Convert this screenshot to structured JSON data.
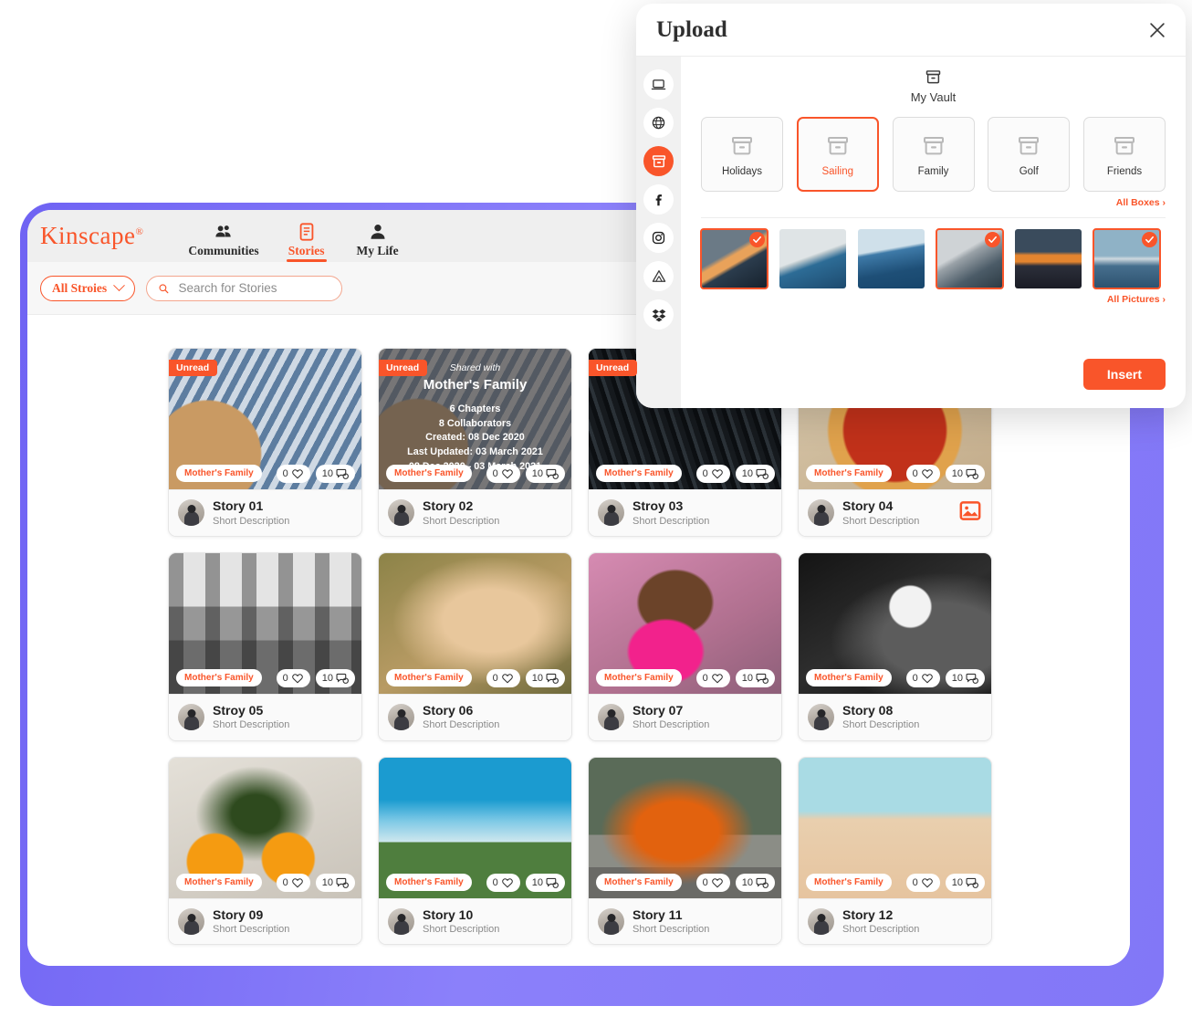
{
  "app": {
    "logo": "Kinscape",
    "logo_reg": "®",
    "nav": [
      {
        "label": "Communities",
        "icon": "people-icon",
        "active": false
      },
      {
        "label": "Stories",
        "icon": "document-icon",
        "active": true
      },
      {
        "label": "My Life",
        "icon": "person-icon",
        "active": false
      }
    ],
    "filter": {
      "label": "All Stroies",
      "icon": "chevron-down-icon"
    },
    "search": {
      "placeholder": "Search for Stories",
      "value": "",
      "icon": "search-icon"
    },
    "cards": [
      {
        "title": "Story 01",
        "subtitle": "Short Description",
        "unread": "Unread",
        "family": "Mother's Family",
        "likes": "0",
        "comments": "10",
        "photo": "ph1"
      },
      {
        "title": "Story 02",
        "subtitle": "Short Description",
        "unread": "Unread",
        "family": "Mother's Family",
        "likes": "0",
        "comments": "10",
        "photo": "ph2",
        "overlay": {
          "shared_with": "Shared with",
          "family": "Mother's Family",
          "lines": [
            "6 Chapters",
            "8 Collaborators",
            "Created: 08 Dec 2020",
            "Last Updated: 03 March 2021",
            "08 Dec 2020 - 03 March 2021"
          ]
        }
      },
      {
        "title": "Stroy 03",
        "subtitle": "Short Description",
        "unread": "Unread",
        "family": "Mother's Family",
        "likes": "0",
        "comments": "10",
        "photo": "ph3"
      },
      {
        "title": "Story 04",
        "subtitle": "Short Description",
        "family": "Mother's Family",
        "likes": "0",
        "comments": "10",
        "photo": "ph4",
        "action_icon": "image-icon"
      },
      {
        "title": "Stroy 05",
        "subtitle": "Short Description",
        "family": "Mother's Family",
        "likes": "0",
        "comments": "10",
        "photo": "ph5"
      },
      {
        "title": "Story 06",
        "subtitle": "Short Description",
        "family": "Mother's Family",
        "likes": "0",
        "comments": "10",
        "photo": "ph6"
      },
      {
        "title": "Story 07",
        "subtitle": "Short Description",
        "family": "Mother's Family",
        "likes": "0",
        "comments": "10",
        "photo": "ph7"
      },
      {
        "title": "Story 08",
        "subtitle": "Short Description",
        "family": "Mother's Family",
        "likes": "0",
        "comments": "10",
        "photo": "ph8"
      },
      {
        "title": "Story 09",
        "subtitle": "Short Description",
        "family": "Mother's Family",
        "likes": "0",
        "comments": "10",
        "photo": "ph9"
      },
      {
        "title": "Story 10",
        "subtitle": "Short Description",
        "family": "Mother's Family",
        "likes": "0",
        "comments": "10",
        "photo": "ph10"
      },
      {
        "title": "Story 11",
        "subtitle": "Short Description",
        "family": "Mother's Family",
        "likes": "0",
        "comments": "10",
        "photo": "ph11"
      },
      {
        "title": "Story 12",
        "subtitle": "Short Description",
        "family": "Mother's Family",
        "likes": "0",
        "comments": "10",
        "photo": "ph12"
      }
    ]
  },
  "modal": {
    "title": "Upload",
    "close_icon": "close-icon",
    "sources": [
      {
        "name": "laptop-icon",
        "active": false
      },
      {
        "name": "globe-icon",
        "active": false
      },
      {
        "name": "vault-box-icon",
        "active": true
      },
      {
        "name": "facebook-icon",
        "active": false
      },
      {
        "name": "instagram-icon",
        "active": false
      },
      {
        "name": "google-drive-icon",
        "active": false
      },
      {
        "name": "dropbox-icon",
        "active": false
      }
    ],
    "vault": {
      "label": "My Vault",
      "icon": "vault-box-icon"
    },
    "boxes": [
      {
        "label": "Holidays",
        "selected": false
      },
      {
        "label": "Sailing",
        "selected": true
      },
      {
        "label": "Family",
        "selected": false
      },
      {
        "label": "Golf",
        "selected": false
      },
      {
        "label": "Friends",
        "selected": false
      }
    ],
    "all_boxes_link": "All Boxes ›",
    "pictures": [
      {
        "selected": true,
        "style": "s1"
      },
      {
        "selected": false,
        "style": "s2"
      },
      {
        "selected": false,
        "style": "s3"
      },
      {
        "selected": true,
        "style": "s4"
      },
      {
        "selected": false,
        "style": "s5"
      },
      {
        "selected": true,
        "style": "s6"
      }
    ],
    "all_pictures_link": "All Pictures ›",
    "insert_label": "Insert"
  },
  "colors": {
    "accent": "#F9552A",
    "purple": "#8277F7",
    "card_bg": "#FFFFFF"
  }
}
